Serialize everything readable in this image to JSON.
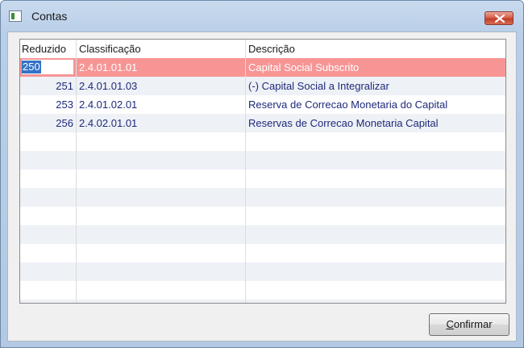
{
  "window": {
    "title": "Contas"
  },
  "grid": {
    "columns": [
      "Reduzido",
      "Classificação",
      "Descrição"
    ],
    "rows": [
      {
        "reduzido": "250",
        "classificacao": "2.4.01.01.01",
        "descricao": "Capital Social Subscrito",
        "selected": true
      },
      {
        "reduzido": "251",
        "classificacao": "2.4.01.01.03",
        "descricao": "(-) Capital Social a Integralizar",
        "selected": false
      },
      {
        "reduzido": "253",
        "classificacao": "2.4.01.02.01",
        "descricao": "Reserva de Correcao Monetaria do Capital",
        "selected": false
      },
      {
        "reduzido": "256",
        "classificacao": "2.4.02.01.01",
        "descricao": "Reservas de Correcao Monetaria Capital",
        "selected": false
      }
    ],
    "empty_rows": 10,
    "colors": {
      "selected_row": "#f79595",
      "text": "#1e2a7a",
      "alt_row": "#eef1f6"
    }
  },
  "footer": {
    "confirm_label_accel": "C",
    "confirm_label_rest": "onfirmar"
  }
}
